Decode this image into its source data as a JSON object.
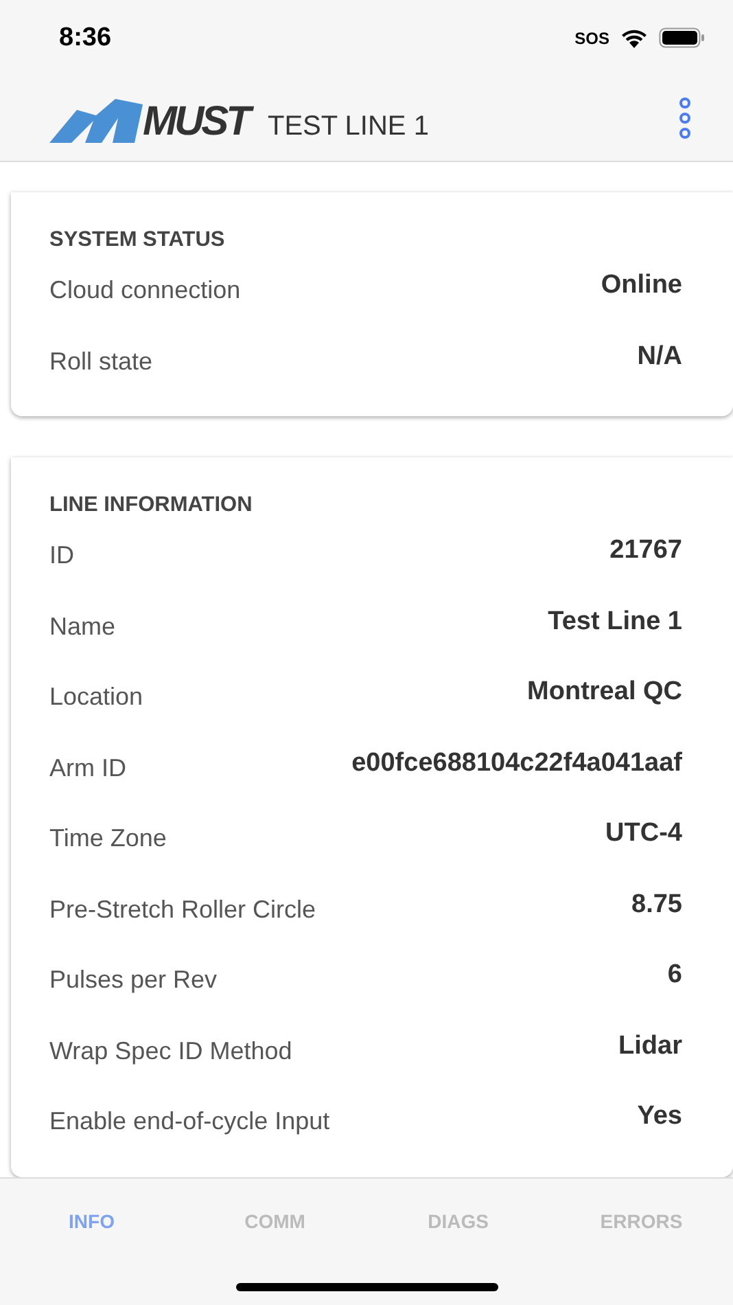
{
  "status_bar": {
    "time": "8:36",
    "carrier": "SOS"
  },
  "header": {
    "logo_text": "MUST",
    "title": "TEST LINE 1"
  },
  "sections": [
    {
      "title": "SYSTEM STATUS",
      "rows": [
        {
          "label": "Cloud connection",
          "value": "Online"
        },
        {
          "label": "Roll state",
          "value": "N/A"
        }
      ]
    },
    {
      "title": "LINE INFORMATION",
      "rows": [
        {
          "label": "ID",
          "value": "21767"
        },
        {
          "label": "Name",
          "value": "Test Line 1"
        },
        {
          "label": "Location",
          "value": "Montreal QC"
        },
        {
          "label": "Arm ID",
          "value": "e00fce688104c22f4a041aaf"
        },
        {
          "label": "Time Zone",
          "value": "UTC-4"
        },
        {
          "label": "Pre-Stretch Roller Circle",
          "value": "8.75"
        },
        {
          "label": "Pulses per Rev",
          "value": "6"
        },
        {
          "label": "Wrap Spec ID Method",
          "value": "Lidar"
        },
        {
          "label": "Enable end-of-cycle Input",
          "value": "Yes"
        }
      ]
    }
  ],
  "tabs": [
    {
      "label": "INFO",
      "selected": true
    },
    {
      "label": "COMM",
      "selected": false
    },
    {
      "label": "DIAGS",
      "selected": false
    },
    {
      "label": "ERRORS",
      "selected": false
    }
  ]
}
